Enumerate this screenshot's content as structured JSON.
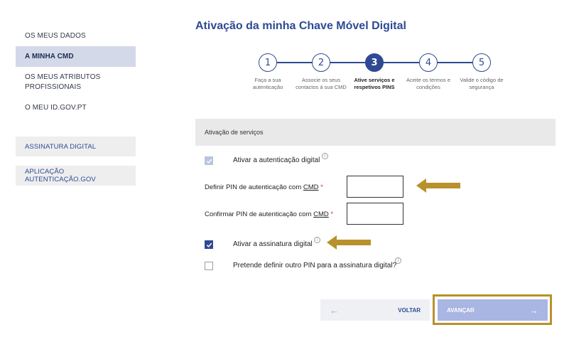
{
  "sidebar": {
    "items": [
      {
        "label": "OS MEUS DADOS"
      },
      {
        "label": "A MINHA CMD"
      },
      {
        "label": "OS MEUS ATRIBUTOS PROFISSIONAIS"
      },
      {
        "label": "O MEU ID.GOV.PT"
      }
    ],
    "boxes": [
      {
        "label": "ASSINATURA DIGITAL"
      },
      {
        "label": "APLICAÇÃO AUTENTICAÇÃO.GOV"
      }
    ]
  },
  "page": {
    "title": "Ativação da minha Chave Móvel Digital"
  },
  "stepper": {
    "current_step": 3,
    "steps": [
      {
        "number": "1",
        "label": "Faça a sua autenticação"
      },
      {
        "number": "2",
        "label": "Associe os seus contactos à sua CMD"
      },
      {
        "number": "3",
        "label": "Ative serviços e respetivos PINS"
      },
      {
        "number": "4",
        "label": "Aceite os termos e condições"
      },
      {
        "number": "5",
        "label": "Valide o código de segurança"
      }
    ]
  },
  "services": {
    "section_title": "Ativação de serviços",
    "activate_auth_label": "Ativar a autenticação digital",
    "activate_auth_checked": true,
    "activate_auth_disabled": true,
    "define_pin_label": "Definir PIN de autenticação com",
    "confirm_pin_label": "Confirmar PIN de autenticação com",
    "cmd_abbr": "CMD",
    "required_mark": "*",
    "define_pin_value": "",
    "confirm_pin_value": "",
    "activate_signature_label": "Ativar a assinatura digital",
    "activate_signature_checked": true,
    "other_pin_label": "Pretende definir outro PIN para a assinatura digital?",
    "other_pin_checked": false,
    "info_glyph": "i"
  },
  "actions": {
    "back_label": "VOLTAR",
    "next_label": "AVANÇAR",
    "back_arrow": "←",
    "next_arrow": "→"
  },
  "colors": {
    "brand": "#2f4a93",
    "annotation_arrow": "#b8912c",
    "next_button": "#a9b5e2"
  }
}
